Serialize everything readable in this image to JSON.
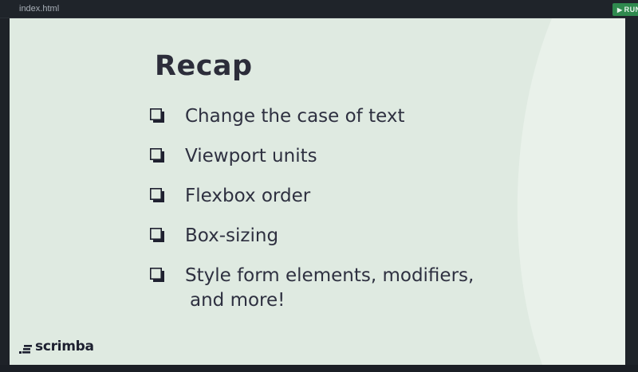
{
  "editor": {
    "tab_label": "index.html",
    "run_label": "RUN",
    "run_icon": "play-icon",
    "run_color": "#2f8a4e"
  },
  "slide": {
    "title": "Recap",
    "background": "#dfeae1",
    "items": [
      {
        "lines": [
          "Change the case of text"
        ]
      },
      {
        "lines": [
          "Viewport units"
        ]
      },
      {
        "lines": [
          "Flexbox order"
        ]
      },
      {
        "lines": [
          "Box-sizing"
        ]
      },
      {
        "lines": [
          "Style form elements, modifiers,",
          "and more!"
        ]
      }
    ],
    "checkbox_icon": "checkbox-icon",
    "brand": "scrimba"
  }
}
